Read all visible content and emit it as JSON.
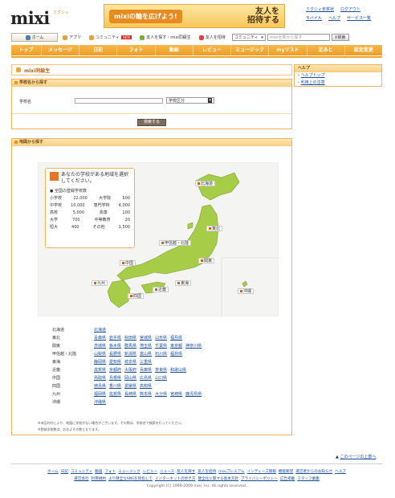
{
  "header": {
    "logo": "mixi",
    "logo_sub": "ミクシィ",
    "banner_left": "mixiの輪を広げよう!",
    "banner_right_1": "友人を",
    "banner_right_2": "招待する",
    "links_row1": [
      "ミクシィ年賀状",
      "ログアウト"
    ],
    "links_row2": [
      "モバイル",
      "ヘルプ",
      "サービス一覧"
    ]
  },
  "nav": {
    "home": "ホーム",
    "apps": "アプリ",
    "community": "コミュニティ",
    "new_badge": "NEW",
    "find_friends": "友人を探す・mixi同級生",
    "invite": "友人を招待",
    "search_scope": "コミュニティ",
    "search_placeholder": "mixi全体から探す",
    "search_button": "検索"
  },
  "tabs": [
    "トップ",
    "メッセージ",
    "日記",
    "フォト",
    "動画",
    "レビュー",
    "ミュージック",
    "myリスト",
    "足あと",
    "設定変更"
  ],
  "page_title": "mixi同級生",
  "school_search": {
    "heading": "学校名から探す",
    "field_label": "学校名",
    "select_value": "学校区分",
    "button": "検索する"
  },
  "map_section": {
    "heading": "地図から探す",
    "legend_title": "あなたの学校がある地域を選択してください。",
    "legend_sub": "全国の登録学校数",
    "counts": [
      [
        "小学校",
        "22,000",
        "大学院",
        "500"
      ],
      [
        "中学校",
        "10,000",
        "専門学校",
        "4,000"
      ],
      [
        "高校",
        "5,000",
        "高専",
        "100"
      ],
      [
        "大学",
        "700",
        "中等教育",
        "20"
      ],
      [
        "短大",
        "400",
        "その他",
        "1,500"
      ]
    ],
    "regions": [
      "北海道",
      "東北",
      "甲信越・北陸",
      "関東",
      "中国",
      "近畿",
      "東海",
      "九州",
      "四国",
      "沖縄"
    ]
  },
  "prefs": [
    [
      "北海道",
      [
        "北海道"
      ]
    ],
    [
      "東北",
      [
        "青森県",
        "岩手県",
        "秋田県",
        "宮城県",
        "山形県",
        "福島県"
      ]
    ],
    [
      "関東",
      [
        "茨城県",
        "栃木県",
        "群馬県",
        "埼玉県",
        "千葉県",
        "東京都",
        "神奈川県"
      ]
    ],
    [
      "甲信越・北陸",
      [
        "山梨県",
        "長野県",
        "新潟県",
        "富山県",
        "石川県",
        "福井県"
      ]
    ],
    [
      "東海",
      [
        "静岡県",
        "愛知県",
        "岐阜県",
        "三重県"
      ]
    ],
    [
      "近畿",
      [
        "滋賀県",
        "京都府",
        "大阪府",
        "兵庫県",
        "奈良県",
        "和歌山県"
      ]
    ],
    [
      "中国",
      [
        "鳥取県",
        "島根県",
        "岡山県",
        "広島県",
        "山口県"
      ]
    ],
    [
      "四国",
      [
        "徳島県",
        "香川県",
        "愛媛県",
        "高知県"
      ]
    ],
    [
      "九州",
      [
        "福岡県",
        "佐賀県",
        "長崎県",
        "熊本県",
        "大分県",
        "宮崎県",
        "鹿児島県"
      ]
    ],
    [
      "沖縄",
      [
        "沖縄県"
      ]
    ]
  ],
  "notes": [
    "※市区町村により、地図に学校がない場合がございます。その際は、学校名で検索を行ってください。",
    "※登録学校数は、おおよその数となります。"
  ],
  "help": {
    "heading": "ヘルプ",
    "items": [
      "ヘルプトップ",
      "利用上の注意"
    ]
  },
  "page_top": "このページの上部へ",
  "footer": {
    "row1": [
      "ホーム",
      "日記",
      "コミュニティ",
      "動画",
      "フォト",
      "ミュージック",
      "レビュー",
      "ニュース",
      "友人を探す",
      "友人を招待",
      "mixiプレミアム",
      "インディーズ情報",
      "機能要望",
      "運営者からのお知らせ",
      "ヘルプ"
    ],
    "row2": [
      "運営会社",
      "利用規約",
      "より健全なSNSを目指して",
      "インターネットの歩き方",
      "健全化に関する基本方針",
      "プライバシーポリシー",
      "広告掲載",
      "スタッフ募集"
    ],
    "copyright": "Copyright (C) 1999-2009 mixi, Inc. All rights reserved."
  },
  "colors": {
    "accent": "#f2a22b",
    "map_green": "#a7cc48",
    "link": "#1a4da3"
  }
}
